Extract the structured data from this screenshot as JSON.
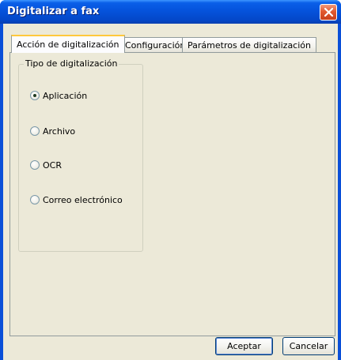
{
  "window": {
    "title": "Digitalizar a fax"
  },
  "tabs": [
    {
      "label": "Acción de digitalización",
      "active": true
    },
    {
      "label": "Configuración",
      "active": false
    },
    {
      "label": "Parámetros de digitalización",
      "active": false
    }
  ],
  "scan_type": {
    "group_label": "Tipo de digitalización",
    "options": [
      {
        "label": "Aplicación",
        "selected": true
      },
      {
        "label": "Archivo",
        "selected": false
      },
      {
        "label": "OCR",
        "selected": false
      },
      {
        "label": "Correo electrónico",
        "selected": false
      }
    ]
  },
  "buttons": {
    "accept": "Aceptar",
    "cancel": "Cancelar"
  },
  "colors": {
    "titlebar": "#0553dc",
    "dialog_background": "#ece9d8",
    "close_button": "#e2592f",
    "active_tab_highlight": "#ffc83c"
  },
  "icons": {
    "close": "close-icon"
  }
}
